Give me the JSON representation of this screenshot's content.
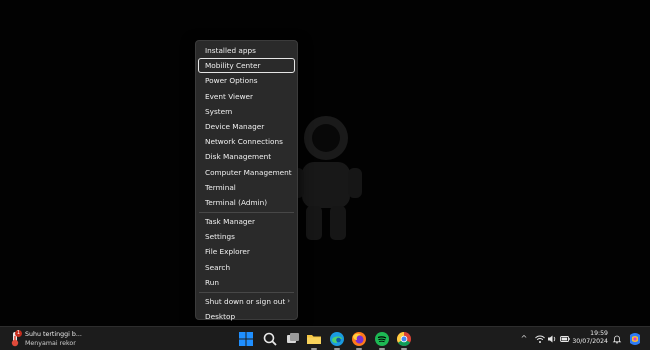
{
  "context_menu": {
    "group1": [
      {
        "label": "Installed apps"
      },
      {
        "label": "Mobility Center"
      },
      {
        "label": "Power Options"
      },
      {
        "label": "Event Viewer"
      },
      {
        "label": "System"
      },
      {
        "label": "Device Manager"
      },
      {
        "label": "Network Connections"
      },
      {
        "label": "Disk Management"
      },
      {
        "label": "Computer Management"
      },
      {
        "label": "Terminal"
      },
      {
        "label": "Terminal (Admin)"
      }
    ],
    "group2": [
      {
        "label": "Task Manager"
      },
      {
        "label": "Settings"
      },
      {
        "label": "File Explorer"
      },
      {
        "label": "Search"
      },
      {
        "label": "Run"
      }
    ],
    "group3": [
      {
        "label": "Shut down or sign out",
        "chevron": "›"
      },
      {
        "label": "Desktop"
      }
    ]
  },
  "taskbar": {
    "widget": {
      "title": "Suhu tertinggi b...",
      "subtitle": "Menyamai rekor",
      "badge": "1",
      "icon": "thermometer-icon"
    },
    "apps": [
      {
        "name": "start-icon"
      },
      {
        "name": "search-icon"
      },
      {
        "name": "task-view-icon"
      },
      {
        "name": "file-explorer-icon"
      },
      {
        "name": "edge-icon"
      },
      {
        "name": "firefox-icon"
      },
      {
        "name": "spotify-icon"
      },
      {
        "name": "chrome-icon"
      }
    ],
    "tray": {
      "chevron": "^",
      "icons": [
        "wifi-icon",
        "volume-icon",
        "battery-icon"
      ],
      "time": "19:59",
      "date": "30/07/2024"
    }
  },
  "colors": {
    "menu_bg": "#2a2a2a",
    "taskbar_bg": "#1c1c1c",
    "windows_blue": "#1f8fff",
    "spotify_green": "#1db954",
    "badge_red": "#c42b1c"
  }
}
